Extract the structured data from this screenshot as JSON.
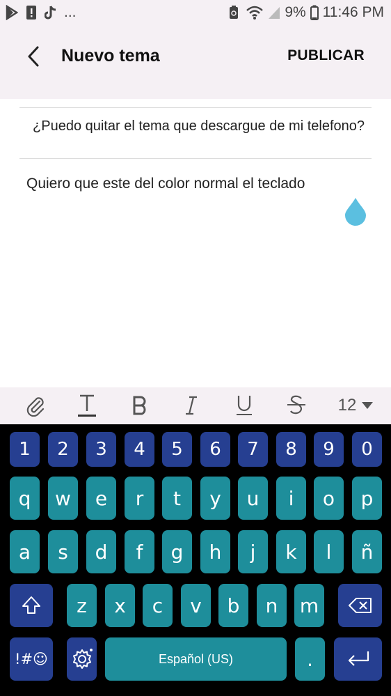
{
  "status_bar": {
    "left_icons": [
      "play-store-icon",
      "alert-icon",
      "tiktok-icon"
    ],
    "overflow": "...",
    "battery_percent": "9%",
    "time": "11:46 PM"
  },
  "app_bar": {
    "title": "Nuevo tema",
    "publish_label": "PUBLICAR"
  },
  "editor": {
    "subject": "¿Puedo quitar el tema que descargue de mi telefono?",
    "body": "Quiero que este del color normal el teclado"
  },
  "format_toolbar": {
    "font_size": "12",
    "tools": [
      "attach-icon",
      "text-style-icon",
      "bold-icon",
      "italic-icon",
      "underline-icon",
      "strikethrough-icon"
    ]
  },
  "keyboard": {
    "row_numbers": [
      "1",
      "2",
      "3",
      "4",
      "5",
      "6",
      "7",
      "8",
      "9",
      "0"
    ],
    "row_1": [
      "q",
      "w",
      "e",
      "r",
      "t",
      "y",
      "u",
      "i",
      "o",
      "p"
    ],
    "row_2": [
      "a",
      "s",
      "d",
      "f",
      "g",
      "h",
      "j",
      "k",
      "l",
      "ñ"
    ],
    "row_3": [
      "z",
      "x",
      "c",
      "v",
      "b",
      "n",
      "m"
    ],
    "symbols_label": "!#☺",
    "space_label": "Español (US)",
    "period_label": "."
  },
  "colors": {
    "function_key": "#263f91",
    "letter_key": "#1e8e9b",
    "keyboard_bg": "#000000",
    "header_bg": "#f5f0f4",
    "cursor_handle": "#5bbfe0"
  }
}
